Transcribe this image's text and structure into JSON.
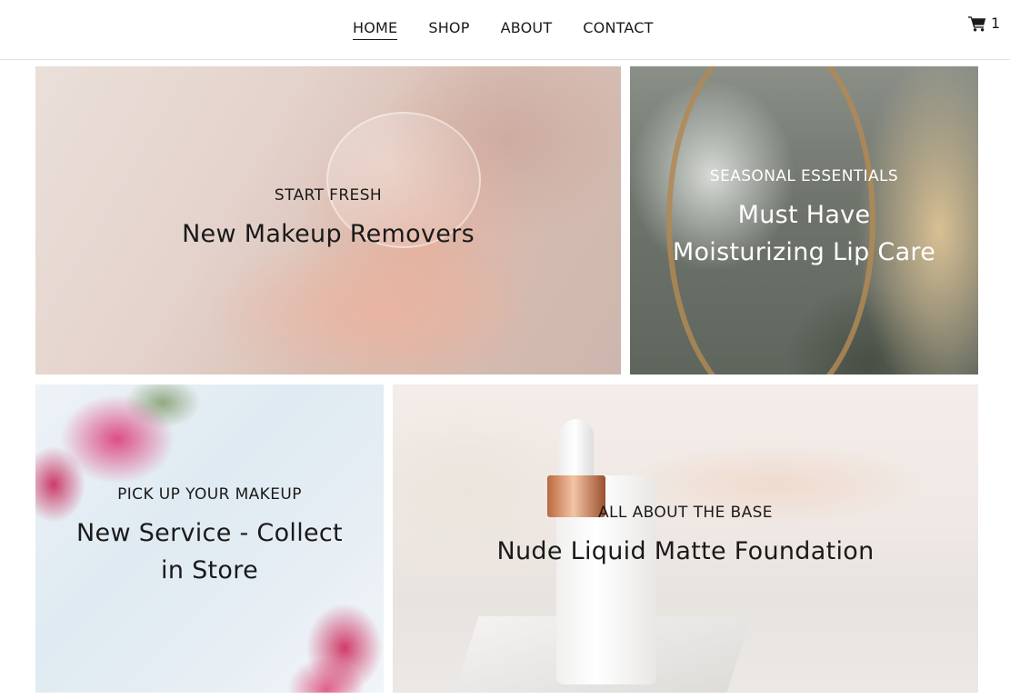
{
  "nav": {
    "items": [
      "HOME",
      "SHOP",
      "ABOUT",
      "CONTACT"
    ],
    "active": "HOME"
  },
  "cart": {
    "icon": "shopping-cart-icon",
    "count": "1"
  },
  "tiles": [
    {
      "eyebrow": "START FRESH",
      "headline_line1": "New Makeup Removers",
      "headline_line2": ""
    },
    {
      "eyebrow": "SEASONAL ESSENTIALS",
      "headline_line1": "Must Have",
      "headline_line2": "Moisturizing Lip Care"
    },
    {
      "eyebrow": "PICK UP YOUR MAKEUP",
      "headline_line1": "New Service - Collect",
      "headline_line2": "in Store"
    },
    {
      "eyebrow": "ALL ABOUT THE BASE",
      "headline_line1": "Nude Liquid Matte Foundation",
      "headline_line2": ""
    }
  ],
  "colors": {
    "text": "#1a1a1a",
    "text_on_dark": "#ffffff",
    "header_border": "#e3e3e3"
  }
}
